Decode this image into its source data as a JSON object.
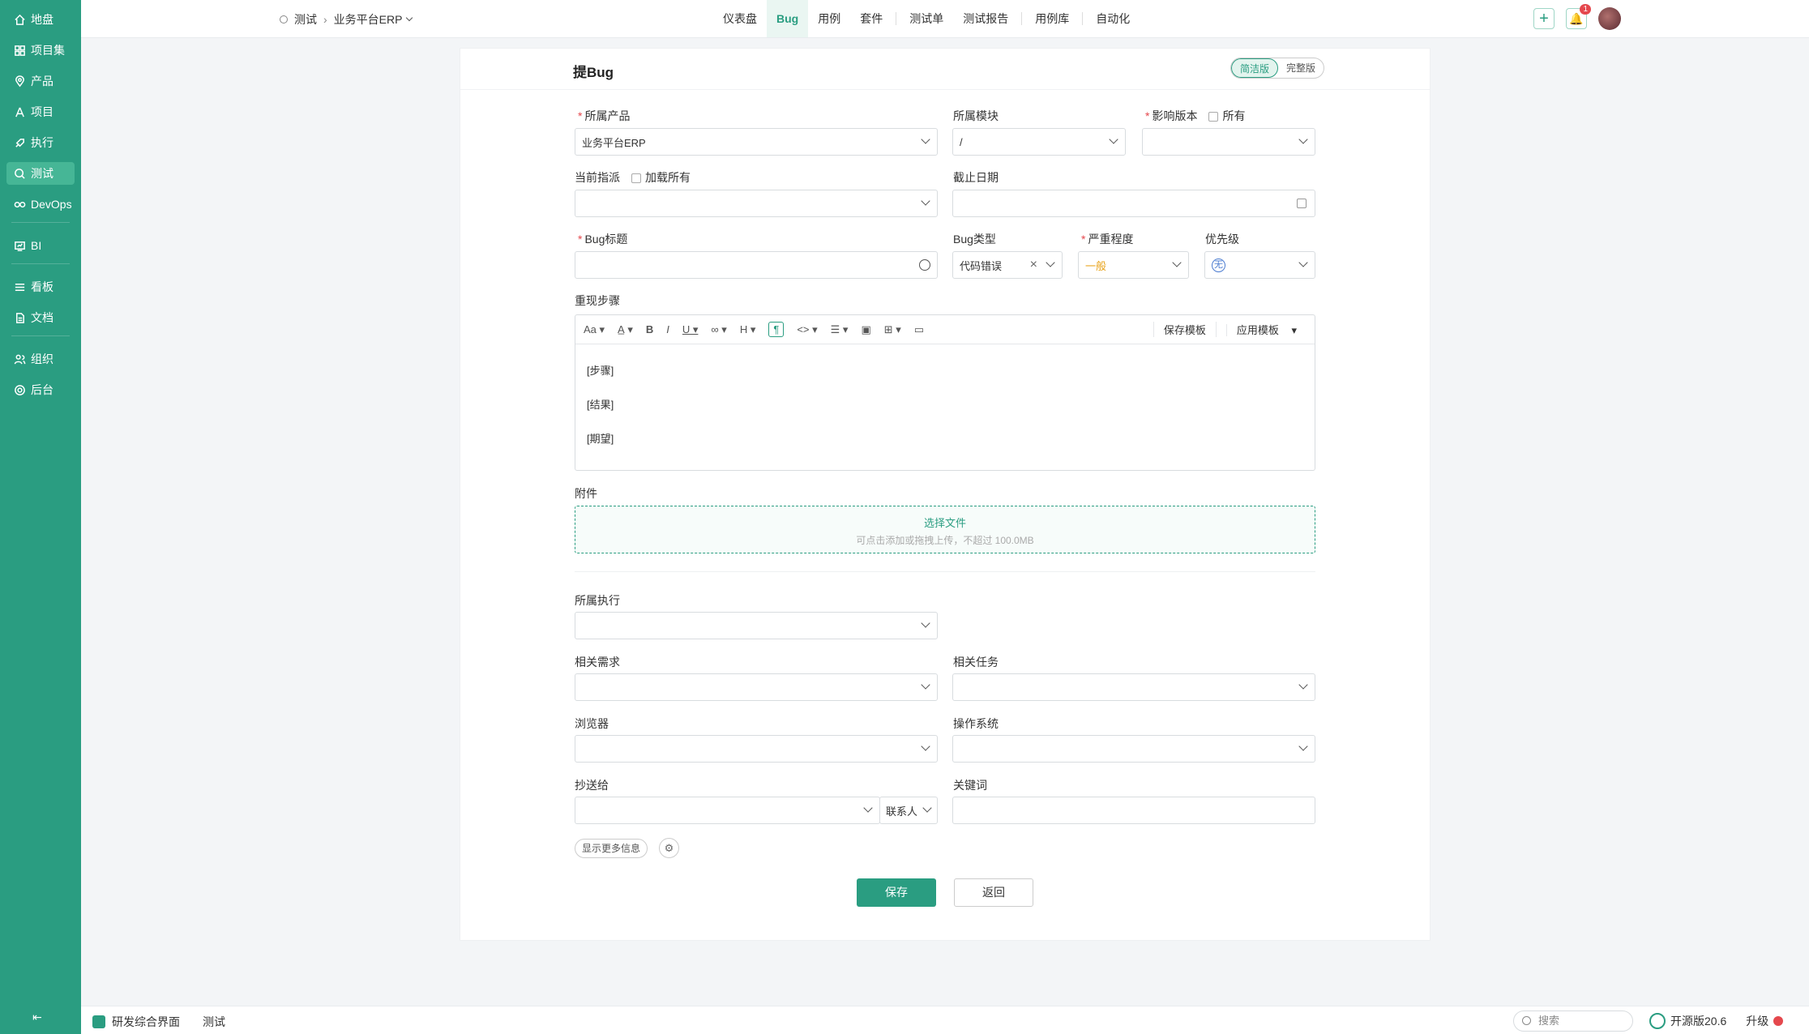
{
  "sidebar": {
    "items": [
      {
        "label": "地盘",
        "icon": "home-icon"
      },
      {
        "label": "项目集",
        "icon": "grid-icon"
      },
      {
        "label": "产品",
        "icon": "location-icon"
      },
      {
        "label": "项目",
        "icon": "project-icon"
      },
      {
        "label": "执行",
        "icon": "rocket-icon"
      },
      {
        "label": "测试",
        "icon": "search-icon"
      },
      {
        "label": "DevOps",
        "icon": "infinity-icon"
      },
      {
        "label": "BI",
        "icon": "chart-icon"
      },
      {
        "label": "看板",
        "icon": "board-icon"
      },
      {
        "label": "文档",
        "icon": "doc-icon"
      },
      {
        "label": "组织",
        "icon": "users-icon"
      },
      {
        "label": "后台",
        "icon": "gear-icon"
      }
    ],
    "active": "测试",
    "collapse_icon": "⇤"
  },
  "topbar": {
    "breadcrumb_module": "测试",
    "breadcrumb_product": "业务平台ERP",
    "nav": [
      "仪表盘",
      "Bug",
      "用例",
      "套件",
      "测试单",
      "测试报告",
      "用例库",
      "自动化"
    ],
    "nav_active": "Bug",
    "notification_count": "1"
  },
  "form": {
    "title": "提Bug",
    "mode_simple": "简洁版",
    "mode_full": "完整版",
    "product_label": "所属产品",
    "product_value": "业务平台ERP",
    "module_label": "所属模块",
    "module_value": "/",
    "version_label": "影响版本",
    "version_all": "所有",
    "assign_label": "当前指派",
    "assign_load_all": "加载所有",
    "deadline_label": "截止日期",
    "bug_title_label": "Bug标题",
    "bug_type_label": "Bug类型",
    "bug_type_value": "代码错误",
    "severity_label": "严重程度",
    "severity_value": "一般",
    "priority_label": "优先级",
    "priority_value": "无",
    "steps_label": "重现步骤",
    "editor_save_template": "保存模板",
    "editor_apply_template": "应用模板",
    "steps_lines": [
      "[步骤]",
      "[结果]",
      "[期望]"
    ],
    "attachment_label": "附件",
    "upload_title": "选择文件",
    "upload_hint": "可点击添加或拖拽上传，不超过 100.0MB",
    "execution_label": "所属执行",
    "story_label": "相关需求",
    "task_label": "相关任务",
    "browser_label": "浏览器",
    "os_label": "操作系统",
    "cc_label": "抄送给",
    "contacts_label": "联系人",
    "keywords_label": "关键词",
    "more_info": "显示更多信息",
    "save": "保存",
    "back": "返回"
  },
  "bottombar": {
    "app_name": "研发综合界面",
    "tab": "测试",
    "search_placeholder": "搜索",
    "edition": "开源版20.6",
    "upgrade": "升级"
  },
  "colors": {
    "brand": "#2a9d81",
    "severity": "#e8a31a"
  }
}
